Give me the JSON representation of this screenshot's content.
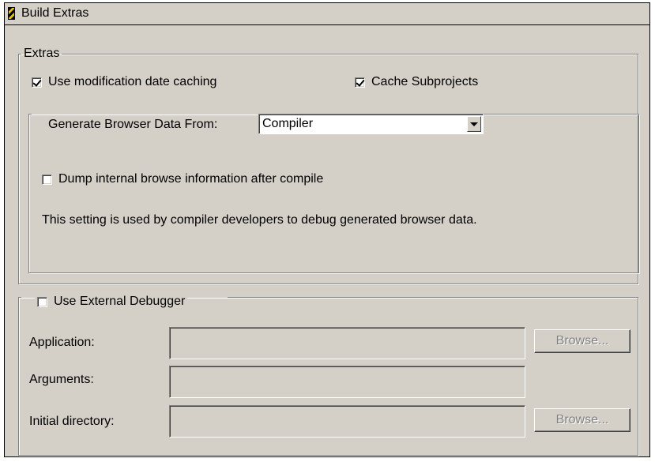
{
  "window": {
    "title": "Build Extras",
    "icon": "build-extras-icon"
  },
  "extras": {
    "legend": "Extras",
    "use_mod_date_caching": {
      "label": "Use modification date caching",
      "checked": true
    },
    "cache_subprojects": {
      "label": "Cache Subprojects",
      "checked": true
    },
    "browser": {
      "legend": "Generate Browser Data From:",
      "selected": "Compiler",
      "dump_info": {
        "label": "Dump internal browse information after compile",
        "checked": false
      },
      "note": "This setting is used by compiler developers to debug generated browser data."
    }
  },
  "debugger": {
    "legend": "Use External Debugger",
    "checked": false,
    "application": {
      "label": "Application:",
      "value": ""
    },
    "arguments": {
      "label": "Arguments:",
      "value": ""
    },
    "initial_directory": {
      "label": "Initial directory:",
      "value": ""
    },
    "browse_label": "Browse..."
  }
}
